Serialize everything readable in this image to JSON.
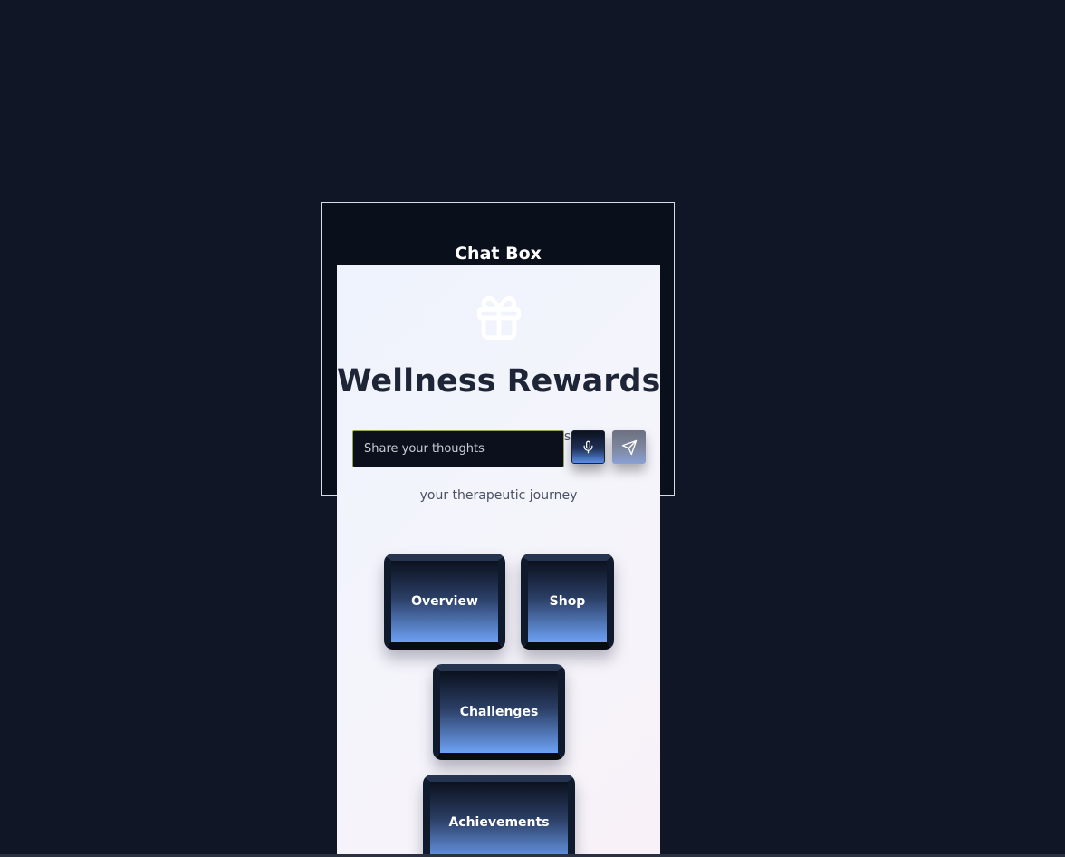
{
  "chat_box": {
    "title": "Chat Box",
    "input": {
      "placeholder": "Share your thoughts",
      "value": ""
    },
    "mic_icon": "microphone-icon",
    "send_icon": "send-icon"
  },
  "rewards": {
    "icon": "gift-icon",
    "title": "Wellness Rewards",
    "subtitle_line1": "ess on",
    "subtitle_line2": "your therapeutic journey",
    "tabs": [
      {
        "label": "Overview"
      },
      {
        "label": "Shop"
      },
      {
        "label": "Challenges"
      },
      {
        "label": "Achievements"
      }
    ]
  },
  "colors": {
    "page_background": "#101626",
    "chat_box_background": "#0a0f1c",
    "panel_background": "#f4f5fb",
    "title_text": "#1e2536",
    "button_gradient_bottom": "#6da1f4",
    "input_border": "#9aa34e"
  }
}
